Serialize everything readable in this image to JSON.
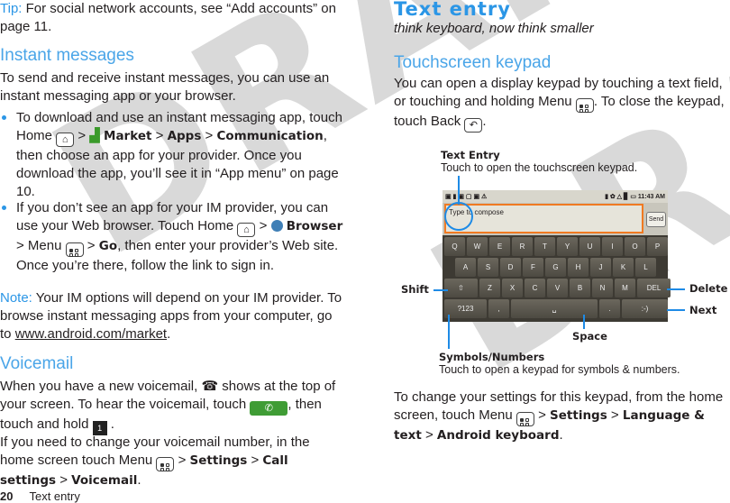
{
  "watermark": "DRAFT",
  "left": {
    "tip_label": "Tip:",
    "tip_text": " For social network accounts, see “Add accounts” on page 11.",
    "im_heading": "Instant messages",
    "im_intro": "To send and receive instant messages, you can use an instant messaging app or your browser.",
    "b1_a": "To download and use an instant messaging app, touch Home ",
    "b1_market": "Market",
    "b1_apps": "Apps",
    "b1_comm": "Communication",
    "b1_b": ", then choose an app for your provider. Once you download the app, you’ll see it in “App menu” on page 10.",
    "b2_a": "If you don’t see an app for your IM provider, you can use your Web browser. Touch Home ",
    "b2_browser": "Browser",
    "b2_menu": " > Menu ",
    "b2_go": "Go",
    "b2_b": ", then enter your provider’s Web site. Once you’re there, follow the link to sign in.",
    "note_label": "Note:",
    "note_text": " Your IM options will depend on your IM provider. To browse instant messaging apps from your computer, go to ",
    "note_link": "www.android.com/market",
    "vm_heading": "Voicemail",
    "vm_p1_a": "When you have a new voicemail, ",
    "vm_p1_b": " shows at the top of your screen. To hear the voicemail, touch ",
    "vm_p1_c": ", then touch and hold ",
    "vm_p2_a": "If you need to change your voicemail number, in the home screen touch Menu ",
    "vm_settings": "Settings",
    "vm_call": "Call settings",
    "vm_voicemail": "Voicemail"
  },
  "footer": {
    "page_number": "20",
    "section": "Text entry"
  },
  "right": {
    "title": "Text entry",
    "subtitle": "think keyboard, now think smaller",
    "keypad_heading": "Touchscreen keypad",
    "keypad_a": "You can open a display keypad by touching a text field, or touching and holding Menu ",
    "keypad_b": ". To close the keypad, touch Back ",
    "settings_a": "To change your settings for this keypad, from the home screen, touch Menu ",
    "settings_b": "Settings",
    "settings_c": "Language & text",
    "settings_d": "Android keyboard"
  },
  "callouts": {
    "text_entry_title": "Text Entry",
    "text_entry_desc": "Touch to open the touchscreen keypad.",
    "shift": "Shift",
    "delete": "Delete",
    "next": "Next",
    "space": "Space",
    "symbols_title": "Symbols/Numbers",
    "symbols_desc": "Touch to open a keypad for symbols & numbers."
  },
  "phone": {
    "time": "11:43 AM",
    "compose_placeholder": "Type to compose",
    "send": "Send",
    "row1": [
      "Q",
      "W",
      "E",
      "R",
      "T",
      "Y",
      "U",
      "I",
      "O",
      "P"
    ],
    "row2": [
      "A",
      "S",
      "D",
      "F",
      "G",
      "H",
      "J",
      "K",
      "L"
    ],
    "row3": [
      "Z",
      "X",
      "C",
      "V",
      "B",
      "N",
      "M"
    ],
    "shift_key": "⇧",
    "del_key": "DEL",
    "sym_key": "?123",
    "comma_key": ",",
    "space_key": "␣",
    "period_key": ".",
    "smiley_key": ":-)"
  }
}
